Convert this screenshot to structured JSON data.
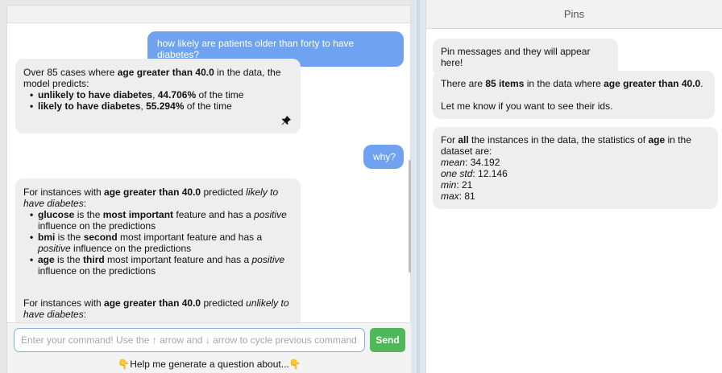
{
  "chat": {
    "msg1_user": "how likely are patients older than forty to have diabetes?",
    "msg2": {
      "intro_a": "Over 85 cases where ",
      "intro_b": "age greater than 40.0",
      "intro_c": " in the data, the model predicts:",
      "item1_b": "unlikely to have diabetes",
      "item1_c": ", ",
      "item1_d": "44.706%",
      "item1_e": " of the time",
      "item2_b": "likely to have diabetes",
      "item2_c": ", ",
      "item2_d": "55.294%",
      "item2_e": " of the time"
    },
    "msg3_user": "why?",
    "msg4": {
      "p1_a": "For instances with ",
      "p1_b": "age greater than 40.0",
      "p1_c": " predicted ",
      "p1_d": "likely to have diabetes",
      "p1_e": ":",
      "i1_a": "glucose",
      "i1_b": " is the ",
      "i1_c": "most important",
      "i1_d": " feature and has a ",
      "i1_e": "positive",
      "i1_f": " influence on the predictions",
      "i2_a": "bmi",
      "i2_b": " is the ",
      "i2_c": "second",
      "i2_d": " most important feature and has a ",
      "i2_e": "positive",
      "i2_f": " influence on the predictions",
      "i3_a": "age",
      "i3_b": " is the ",
      "i3_c": "third",
      "i3_d": " most important feature and has a ",
      "i3_e": "positive",
      "i3_f": " influence on the predictions",
      "p2_a": "For instances with ",
      "p2_b": "age greater than 40.0",
      "p2_c": " predicted ",
      "p2_d": "unlikely to have diabetes",
      "p2_e": ":"
    }
  },
  "input": {
    "placeholder": "Enter your command! Use the ↑ arrow and ↓ arrow to cycle previous command",
    "send_label": "Send"
  },
  "help": {
    "label": "Help me generate a question about...",
    "icon": "pointing-down-hand-icon"
  },
  "pins": {
    "title": "Pins",
    "card1": "Pin messages and they will appear here!",
    "card2": {
      "a": "There are ",
      "b": "85 items",
      "c": " in the data where ",
      "d": "age greater than 40.0",
      "e": ".",
      "f": "Let me know if you want to see their ids."
    },
    "card3": {
      "a": "For ",
      "b": "all",
      "c": " the instances in the data, the statistics of ",
      "d": "age",
      "e": " in the dataset are:",
      "mean_label": "mean",
      "mean_val": ": 34.192",
      "std_label": "one std",
      "std_val": ": 12.146",
      "min_label": "min",
      "min_val": ": 21",
      "max_label": "max",
      "max_val": ": 81"
    }
  },
  "colors": {
    "user_bubble": "#6fa3f2",
    "bot_bubble": "#eeeeee",
    "send_button": "#4fb85a",
    "input_border": "#86aee6",
    "help_hand": "#f0b400"
  }
}
